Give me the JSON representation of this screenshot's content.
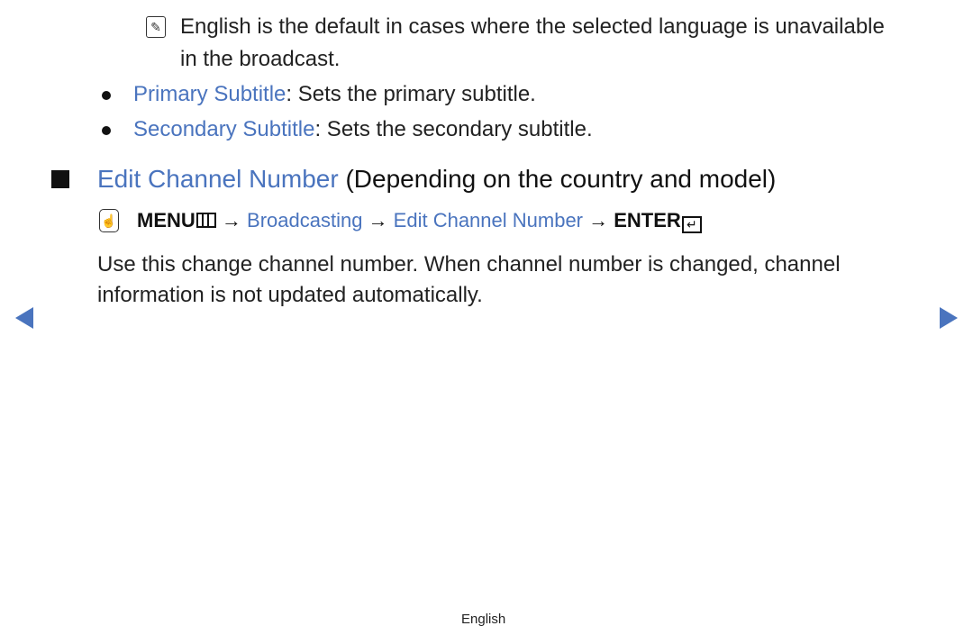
{
  "note": {
    "icon": "note-icon",
    "line1": "English is the default in cases where the selected language is unavailable",
    "line2": "in the broadcast."
  },
  "bullets": [
    {
      "term": "Primary Subtitle",
      "desc": ": Sets the primary subtitle."
    },
    {
      "term": "Secondary Subtitle",
      "desc": ": Sets the secondary subtitle."
    }
  ],
  "section": {
    "title": "Edit Channel Number",
    "qualifier": " (Depending on the country and model)"
  },
  "menu_path": {
    "icon": "hand-pointer-icon",
    "menu": "MENU",
    "arrow": " → ",
    "step1": "Broadcasting",
    "step2": "Edit Channel Number",
    "enter": "ENTER"
  },
  "description": {
    "line1": "Use this change channel number. When channel number is changed, channel",
    "line2": "information is not updated automatically."
  },
  "nav": {
    "prev": "previous-page",
    "next": "next-page"
  },
  "footer": {
    "language": "English"
  },
  "colors": {
    "accent": "#4a74be",
    "text": "#222222"
  }
}
